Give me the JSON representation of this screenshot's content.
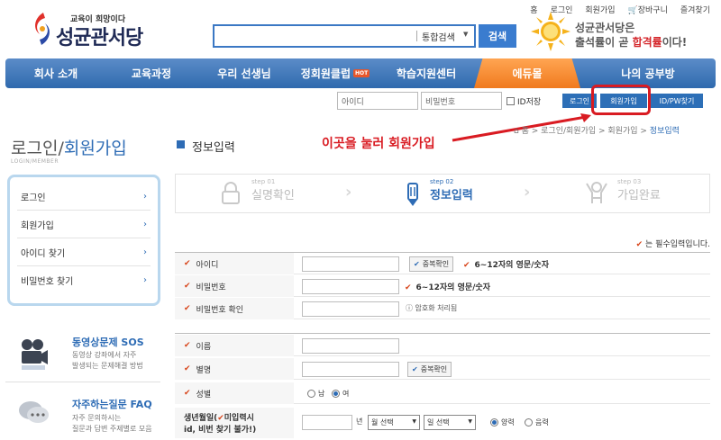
{
  "util_links": [
    "홈",
    "로그인",
    "회원가입",
    "장바구니",
    "즐겨찾기"
  ],
  "logo": {
    "tagline": "교육이 희망이다",
    "name": "성균관서당"
  },
  "search": {
    "category": "통합검색",
    "button": "검색",
    "value": ""
  },
  "promo": {
    "line1": "성균관서당은",
    "line2_a": "출석률이 곧 ",
    "line2_b": "합격률",
    "line2_c": "이다!"
  },
  "nav": {
    "items": [
      "회사 소개",
      "교육과정",
      "우리 선생님",
      "정회원클럽",
      "학습지원센터",
      "에듀몰",
      "나의 공부방"
    ],
    "hot": "HOT"
  },
  "login": {
    "id_placeholder": "아이디",
    "pw_placeholder": "비밀번호",
    "save_id": "ID저장",
    "login": "로그인",
    "join": "회원가입",
    "find": "ID/PW찾기"
  },
  "annotation": "이곳을 눌러 회원가입",
  "sidebar": {
    "title_a": "로그인/",
    "title_b": "회원가입",
    "subtitle": "LOGIN/MEMBER",
    "items": [
      "로그인",
      "회원가입",
      "아이디 찾기",
      "비밀번호 찾기"
    ],
    "sos_title": "동영상문제 SOS",
    "sos_desc1": "동영상 강좌에서 자주",
    "sos_desc2": "발생되는 문제해결 방법",
    "faq_title": "자주하는질문 FAQ",
    "faq_desc1": "자주 문의하시는",
    "faq_desc2": "질문과 답변 주제별로 모음"
  },
  "page": {
    "title": "정보입력",
    "breadcrumb": [
      "홈",
      "로그인/회원가입",
      "회원가입"
    ],
    "breadcrumb_current": "정보입력"
  },
  "steps": [
    {
      "num": "step 01",
      "label": "실명확인"
    },
    {
      "num": "step 02",
      "label": "정보입력"
    },
    {
      "num": "step 03",
      "label": "가입완료"
    }
  ],
  "required_note": "는 필수입력입니다.",
  "form": {
    "id_label": "아이디",
    "id_check": "중복확인",
    "id_hint": "6~12자의 영문/숫자",
    "pw_label": "비밀번호",
    "pw_hint": "6~12자의 영문/숫자",
    "pw2_label": "비밀번호 확인",
    "pw2_hint": "암호화 처리됨",
    "name_label": "이름",
    "nick_label": "별명",
    "nick_check": "중복확인",
    "gender_label": "성별",
    "gender_male": "남",
    "gender_female": "여",
    "birth_label_a": "생년월일(",
    "birth_label_b": "미입력시",
    "birth_label_c": "id, 비번 찾기 불가!)",
    "birth_year_suffix": "년",
    "birth_month": "월 선택",
    "birth_day": "일 선택",
    "cal_solar": "양력",
    "cal_lunar": "음력"
  },
  "colors": {
    "accent": "#2e6cb5",
    "annotation": "#d91b22",
    "nav_active": "#f07a1e"
  }
}
